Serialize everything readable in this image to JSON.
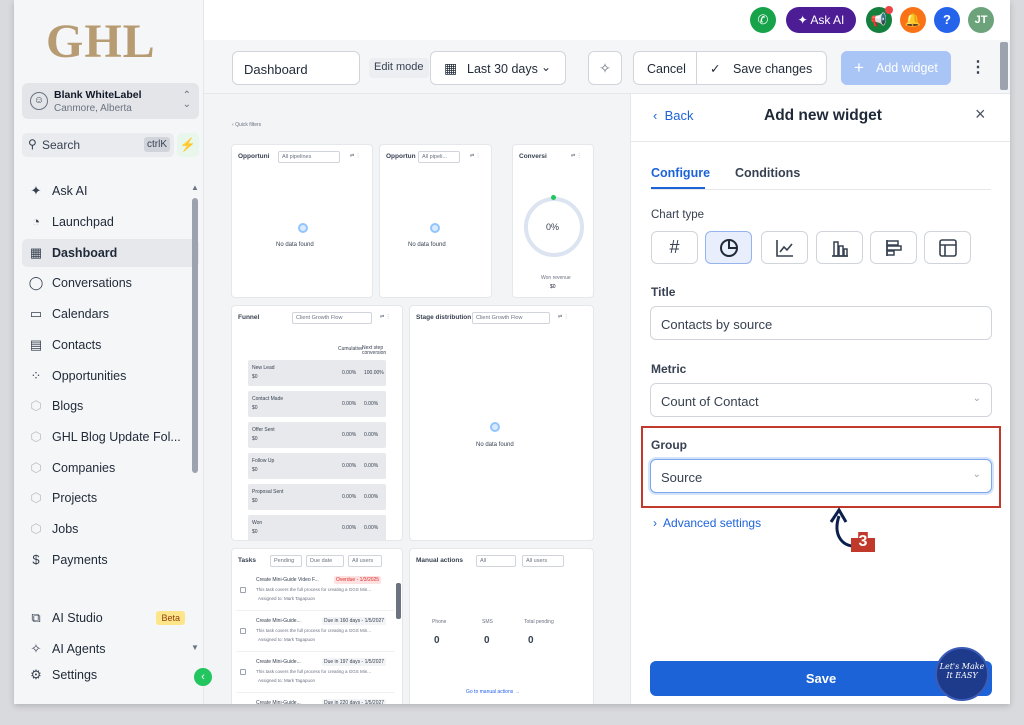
{
  "sidebar": {
    "logo": "GHL",
    "account": {
      "name": "Blank WhiteLabel",
      "location": "Canmore, Alberta"
    },
    "search": {
      "label": "Search",
      "shortcut": "ctrlK"
    },
    "items": [
      {
        "label": "Ask AI",
        "icon": "sparkle-icon"
      },
      {
        "label": "Launchpad",
        "icon": "rocket-icon"
      },
      {
        "label": "Dashboard",
        "icon": "dashboard-grid-icon"
      },
      {
        "label": "Conversations",
        "icon": "chat-bubble-icon"
      },
      {
        "label": "Calendars",
        "icon": "calendar-icon"
      },
      {
        "label": "Contacts",
        "icon": "contacts-icon"
      },
      {
        "label": "Opportunities",
        "icon": "opportunities-icon"
      },
      {
        "label": "Blogs",
        "icon": "cube-icon"
      },
      {
        "label": "GHL Blog Update Fol...",
        "icon": "cube-icon"
      },
      {
        "label": "Companies",
        "icon": "cube-icon"
      },
      {
        "label": "Projects",
        "icon": "cube-icon"
      },
      {
        "label": "Jobs",
        "icon": "cube-icon"
      },
      {
        "label": "Payments",
        "icon": "payments-icon"
      }
    ],
    "bottom_items": [
      {
        "label": "AI Studio",
        "badge": "Beta",
        "icon": "ai-studio-icon"
      },
      {
        "label": "AI Agents",
        "icon": "ai-agents-icon"
      },
      {
        "label": "Settings",
        "icon": "gear-icon"
      }
    ]
  },
  "topbar": {
    "ask_ai": "Ask AI",
    "avatar_initials": "JT",
    "help": "?"
  },
  "toolbar": {
    "dashboard_name": "Dashboard",
    "edit_mode": "Edit mode",
    "date_range": "Last 30 days",
    "cancel": "Cancel",
    "save_changes": "Save changes",
    "add_widget": "Add widget"
  },
  "dashboard": {
    "quick_filters": "Quick filters",
    "card1": {
      "title": "Opportuni",
      "select": "All pipelines",
      "empty": "No data found"
    },
    "card2": {
      "title": "Opportun",
      "select": "All pipeli...",
      "empty": "No data found"
    },
    "card3": {
      "title": "Conversi",
      "value": "0%",
      "sub": "Won revenue",
      "sub_value": "$0"
    },
    "funnel": {
      "title": "Funnel",
      "select": "Client Growth Flow",
      "col1": "Cumulative",
      "col2": "Next step conversion",
      "rows": [
        {
          "stage": "New Lead",
          "amt": "$0",
          "a": "0.00%",
          "b": "100.00%"
        },
        {
          "stage": "Contact Made",
          "amt": "$0",
          "a": "0.00%",
          "b": "0.00%"
        },
        {
          "stage": "Offer Sent",
          "amt": "$0",
          "a": "0.00%",
          "b": "0.00%"
        },
        {
          "stage": "Follow Up",
          "amt": "$0",
          "a": "0.00%",
          "b": "0.00%"
        },
        {
          "stage": "Proposal Sent",
          "amt": "$0",
          "a": "0.00%",
          "b": "0.00%"
        },
        {
          "stage": "Won",
          "amt": "$0",
          "a": "0.00%",
          "b": "0.00%"
        }
      ]
    },
    "stage": {
      "title": "Stage distribution",
      "select": "Client Growth Flow",
      "empty": "No data found"
    },
    "tasks": {
      "title": "Tasks",
      "f1": "Pending",
      "f2": "Due date",
      "f3": "All users",
      "rows": [
        {
          "name": "Create Mini-Guide Video F...",
          "due": "Overdue - 1/3/2025",
          "desc": "This task covers the full process for creating a GGS Min...",
          "who": "Assigned to: Mark Tagapuon"
        },
        {
          "name": "Create Mini-Guide...",
          "due": "Due in 160 days - 1/5/2027",
          "desc": "This task covers the full process for creating a GGS Min...",
          "who": "Assigned to: Mark Tagapuon"
        },
        {
          "name": "Create Mini-Guide...",
          "due": "Due in 197 days - 1/5/2027",
          "desc": "This task covers the full process for creating a GGS Min...",
          "who": "Assigned to: Mark Tagapuon"
        },
        {
          "name": "Create Mini-Guide...",
          "due": "Due in 220 days - 1/5/2027",
          "desc": "",
          "who": ""
        }
      ]
    },
    "manual": {
      "title": "Manual actions",
      "f1": "All",
      "f2": "All users",
      "cols": [
        "Phone",
        "SMS",
        "Total pending"
      ],
      "vals": [
        "0",
        "0",
        "0"
      ],
      "link": "Go to manual actions"
    }
  },
  "panel": {
    "back": "Back",
    "title": "Add new widget",
    "tabs": [
      "Configure",
      "Conditions"
    ],
    "chart_type_label": "Chart type",
    "title_label": "Title",
    "title_value": "Contacts by source",
    "metric_label": "Metric",
    "metric_value": "Count of Contact",
    "group_label": "Group",
    "group_value": "Source",
    "advanced": "Advanced settings",
    "save": "Save",
    "annotation_number": "3",
    "watermark": "Let's Make It EASY",
    "highlight_color": "#c0392b"
  },
  "colors": {
    "accent": "#1d63d8",
    "green": "#22c55e",
    "purple": "#4c1d95",
    "orange": "#f97316"
  }
}
